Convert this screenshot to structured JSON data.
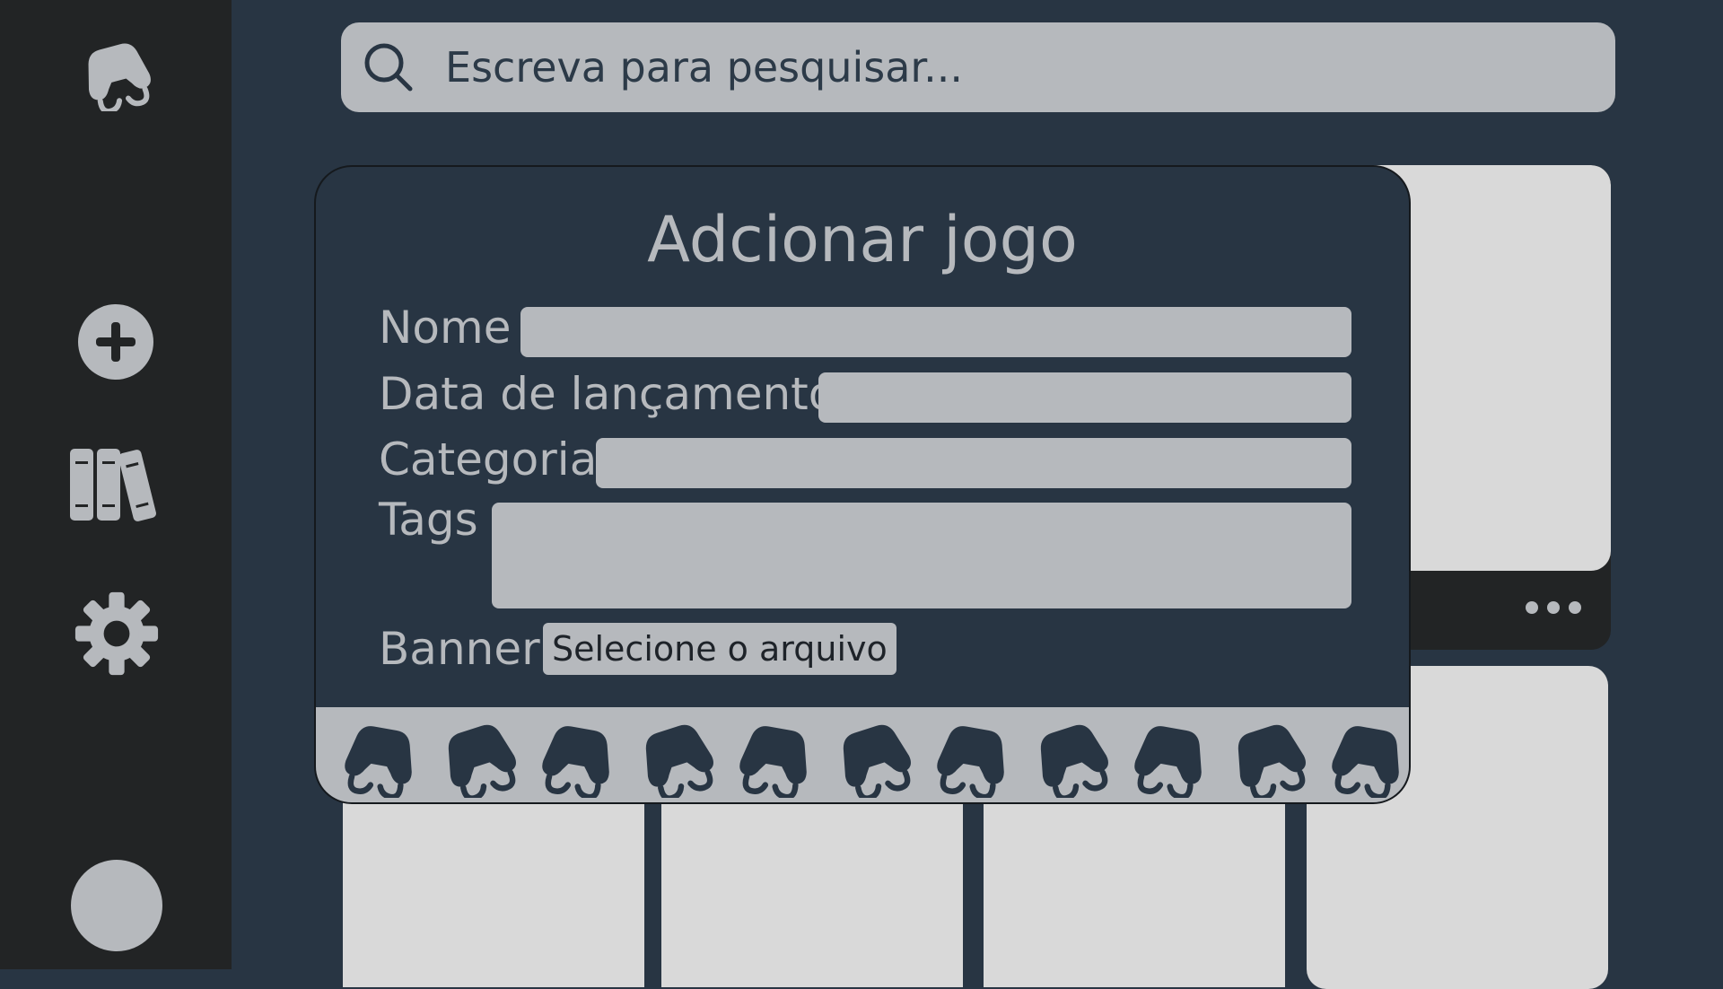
{
  "sidebar": {
    "logo_icon": "gamepad-icon",
    "add_icon": "plus-circle-icon",
    "library_icon": "books-icon",
    "settings_icon": "gear-icon",
    "avatar": "user-avatar"
  },
  "search": {
    "placeholder": "Escreva para pesquisar...",
    "icon": "search-icon"
  },
  "modal": {
    "title": "Adcionar jogo",
    "fields": {
      "name_label": "Nome",
      "release_label": "Data de lançamento",
      "category_label": "Categoria",
      "tags_label": "Tags",
      "banner_label": "Banner",
      "file_button": "Selecione o arquivo"
    },
    "footer_pattern_icon": "gamepad-icon"
  },
  "card": {
    "more_icon": "more-dots-icon"
  },
  "colors": {
    "background": "#283543",
    "sidebar": "#222425",
    "field": "#b6b9bd",
    "card": "#d9d9d9"
  }
}
